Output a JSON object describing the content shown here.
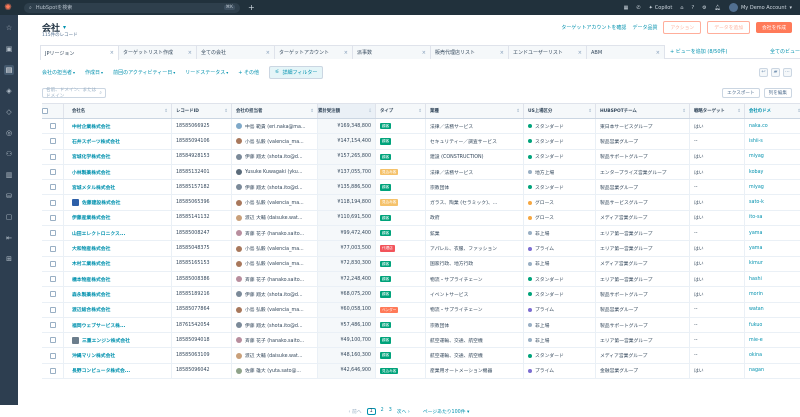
{
  "topbar": {
    "search_placeholder": "HubSpotを検索",
    "shortcut": "⌘K",
    "copilot": "Copilot",
    "account": "My Demo Account"
  },
  "header": {
    "title": "会社",
    "record_count": "115件のレコード",
    "link_target": "ターゲットアカウントを確認",
    "link_quality": "データ品質",
    "actions": "アクション",
    "import": "データを追加",
    "create": "会社を作成"
  },
  "tabs": [
    {
      "label": "JPリージョン",
      "closable": true
    },
    {
      "label": "ターゲットリスト作成",
      "closable": true
    },
    {
      "label": "全ての会社",
      "closable": true
    },
    {
      "label": "ターゲットアカウント",
      "closable": true
    },
    {
      "label": "派事数",
      "closable": true
    },
    {
      "label": "販売代理店リスト",
      "closable": true
    },
    {
      "label": "エンドユーザーリスト",
      "closable": true
    },
    {
      "label": "ABM",
      "closable": true
    }
  ],
  "add_view": "+ ビューを追加 (8/50件)",
  "all_views": "全てのビュー",
  "filters": [
    {
      "label": "会社の担当者"
    },
    {
      "label": "作成日"
    },
    {
      "label": "前回のアクティビティー日"
    },
    {
      "label": "リードステータス"
    },
    {
      "label": "+ その他"
    }
  ],
  "advanced_filter": "詳細フィルター",
  "table_search_placeholder": "名前、ドメイン、またはドメイン",
  "export_label": "エクスポート",
  "edit_columns_label": "列を編集",
  "columns": [
    "会社名",
    "レコードID",
    "会社の担当者",
    "累計受注額",
    "タイプ",
    "業種",
    "US上場区分",
    "HUBSPOTチーム",
    "戦略ターゲット",
    "会社のドメ"
  ],
  "rows": [
    {
      "name": "中村企業株式会社",
      "id": "18585066925",
      "owner": "中島 範貴 (eri.naka@ma...",
      "owner_color": "#7fa9c9",
      "amount": "¥169,348,800",
      "type": "顧客",
      "type_color": "#00a37b",
      "industry": "法律／法務サービス",
      "cls": "スタンダード",
      "cls_color": "#00a37b",
      "team": "東日本サービスグループ",
      "target": "はい",
      "url": "naka.co"
    },
    {
      "name": "石井スポーツ株式会社",
      "id": "18585094106",
      "owner": "小島 弘毅 (valencia_ma...",
      "owner_color": "#a8785c",
      "amount": "¥147,154,400",
      "type": "顧客",
      "type_color": "#00a37b",
      "industry": "セキュリティー／調査サービス",
      "cls": "スタンダード",
      "cls_color": "#00a37b",
      "team": "製品営業グループ",
      "target": "--",
      "url": "ishii-s"
    },
    {
      "name": "宮城化学株式会社",
      "id": "18584928153",
      "owner": "伊藤 翔太 (shota.ito@d...",
      "owner_color": "#7b8a99",
      "amount": "¥157,265,800",
      "type": "顧客",
      "type_color": "#00a37b",
      "industry": "建設 (CONSTRUCTION)",
      "cls": "スタンダード",
      "cls_color": "#00a37b",
      "team": "製品サポートグループ",
      "target": "はい",
      "url": "miyag"
    },
    {
      "name": "小林製薬株式会社",
      "id": "18585132401",
      "owner": "Yusuke Kuwagaki (yku...",
      "owner_color": "#5a6b7a",
      "amount": "¥137,055,700",
      "type": "見込み客",
      "type_color": "#f5c26b",
      "industry": "法律／法務サービス",
      "cls": "地方上場",
      "cls_color": "#99afc4",
      "team": "エンタープライズ営業グループ",
      "target": "はい",
      "url": "kobay"
    },
    {
      "name": "宮城メタル株式会社",
      "id": "18585157182",
      "owner": "伊藤 翔太 (shota.ito@d...",
      "owner_color": "#7b8a99",
      "amount": "¥135,886,500",
      "type": "顧客",
      "type_color": "#00a37b",
      "industry": "宗教団体",
      "cls": "スタンダード",
      "cls_color": "#00a37b",
      "team": "製品営業グループ",
      "target": "--",
      "url": "miyag"
    },
    {
      "name": "佐藤建設株式会社",
      "id": "18585065396",
      "owner": "小島 弘毅 (valencia_ma...",
      "owner_color": "#a8785c",
      "amount": "¥118,194,800",
      "type": "見込み客",
      "type_color": "#f5c26b",
      "industry": "ガラス、陶業 (セラミック)、...",
      "cls": "グロース",
      "cls_color": "#f5a742",
      "team": "製品サービスグループ",
      "target": "はい",
      "url": "sato-k",
      "logo": "#2d5fa8"
    },
    {
      "name": "伊藤産業株式会社",
      "id": "18585141132",
      "owner": "渡辺 大輔 (daisuke.wat...",
      "owner_color": "#c9a07a",
      "amount": "¥110,691,500",
      "type": "顧客",
      "type_color": "#00a37b",
      "industry": "政府",
      "cls": "グロース",
      "cls_color": "#f5a742",
      "team": "メディア営業グループ",
      "target": "はい",
      "url": "ito-sa"
    },
    {
      "name": "山田エレクトロニクス...",
      "id": "18585008247",
      "owner": "斉藤 花子 (hanako.saito...",
      "owner_color": "#b88e9e",
      "amount": "¥99,472,400",
      "type": "顧客",
      "type_color": "#00a37b",
      "industry": "鉱業",
      "cls": "非上場",
      "cls_color": "#99afc4",
      "team": "エリア第一営業グループ",
      "target": "--",
      "url": "yama"
    },
    {
      "name": "大和物産株式会社",
      "id": "18585048375",
      "owner": "小島 弘毅 (valencia_ma...",
      "owner_color": "#a8785c",
      "amount": "¥77,003,500",
      "type": "代理店",
      "type_color": "#f2545b",
      "industry": "アパレル、衣服、ファッション",
      "cls": "プライム",
      "cls_color": "#7c6ed1",
      "team": "エリア第一営業グループ",
      "target": "はい",
      "url": "yama"
    },
    {
      "name": "木村工業株式会社",
      "id": "18585165153",
      "owner": "小島 弘毅 (valencia_ma...",
      "owner_color": "#a8785c",
      "amount": "¥72,830,300",
      "type": "顧客",
      "type_color": "#00a37b",
      "industry": "国家行政、地方行政",
      "cls": "非上場",
      "cls_color": "#99afc4",
      "team": "メディア営業グループ",
      "target": "はい",
      "url": "kimur"
    },
    {
      "name": "橋本物産株式会社",
      "id": "18585008386",
      "owner": "斉藤 花子 (hanako.saito...",
      "owner_color": "#b88e9e",
      "amount": "¥72,248,400",
      "type": "顧客",
      "type_color": "#00a37b",
      "industry": "物流・サプライチェーン",
      "cls": "スタンダード",
      "cls_color": "#00a37b",
      "team": "エリア第一営業グループ",
      "target": "はい",
      "url": "hashi"
    },
    {
      "name": "森永製薬株式会社",
      "id": "18585189216",
      "owner": "伊藤 翔太 (shota.ito@d...",
      "owner_color": "#7b8a99",
      "amount": "¥68,075,200",
      "type": "顧客",
      "type_color": "#00a37b",
      "industry": "イベントサービス",
      "cls": "スタンダード",
      "cls_color": "#00a37b",
      "team": "製品サポートグループ",
      "target": "はい",
      "url": "morin"
    },
    {
      "name": "渡辺総合株式会社",
      "id": "18585077864",
      "owner": "小島 弘毅 (valencia_ma...",
      "owner_color": "#a8785c",
      "amount": "¥60,058,100",
      "type": "ベンダー",
      "type_color": "#ff7a59",
      "industry": "物流・サプライチェーン",
      "cls": "プライム",
      "cls_color": "#7c6ed1",
      "team": "製品営業グループ",
      "target": "--",
      "url": "watan"
    },
    {
      "name": "福岡ウェブサービス株...",
      "id": "18761542054",
      "owner": "伊藤 翔太 (shota.ito@d...",
      "owner_color": "#7b8a99",
      "amount": "¥57,486,100",
      "type": "顧客",
      "type_color": "#00a37b",
      "industry": "宗教団体",
      "cls": "非上場",
      "cls_color": "#99afc4",
      "team": "製品サポートグループ",
      "target": "--",
      "url": "fukuo"
    },
    {
      "name": "三重エンジン株式会社",
      "id": "18585094018",
      "owner": "斉藤 花子 (hanako.saito...",
      "owner_color": "#b88e9e",
      "amount": "¥49,100,700",
      "type": "顧客",
      "type_color": "#00a37b",
      "industry": "航空運輸、交通、航空機",
      "cls": "非上場",
      "cls_color": "#99afc4",
      "team": "エリア第一営業グループ",
      "target": "--",
      "url": "mie-e",
      "logo": "#6b7d8c"
    },
    {
      "name": "沖縄マリン株式会社",
      "id": "18585063109",
      "owner": "渡辺 大輔 (daisuke.wat...",
      "owner_color": "#c9a07a",
      "amount": "¥48,160,300",
      "type": "顧客",
      "type_color": "#00a37b",
      "industry": "航空運輸、交通、航空機",
      "cls": "スタンダード",
      "cls_color": "#00a37b",
      "team": "メディア営業グループ",
      "target": "--",
      "url": "okina"
    },
    {
      "name": "長野コンピュータ株式会...",
      "id": "18585096042",
      "owner": "佐藤 雄大 (yuta.sato@...",
      "owner_color": "#8fa38a",
      "amount": "¥42,646,900",
      "type": "見込み客",
      "type_color": "#00a37b",
      "industry": "産業用オートメーション機器",
      "cls": "プライム",
      "cls_color": "#7c6ed1",
      "team": "金融営業グループ",
      "target": "はい",
      "url": "nagan"
    }
  ],
  "pager": {
    "prev": "前へ",
    "pages": [
      "1",
      "2",
      "3"
    ],
    "current": "1",
    "next": "次へ",
    "per_page": "ページあたり100件"
  }
}
